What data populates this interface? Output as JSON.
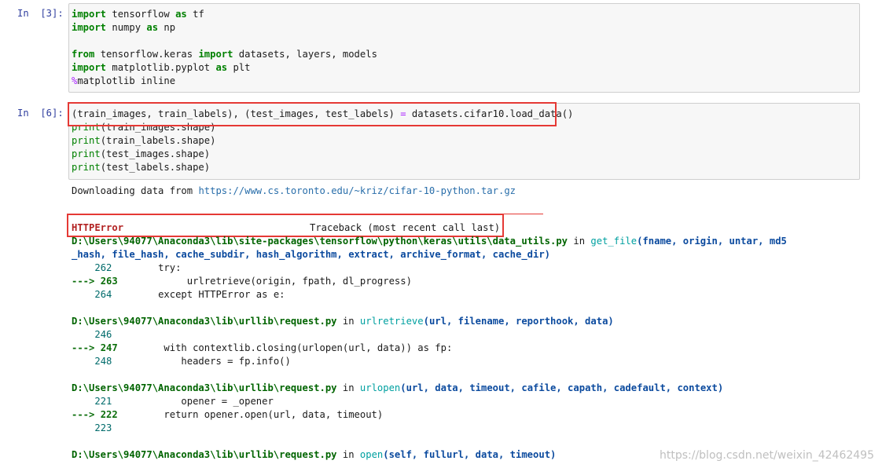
{
  "cell1": {
    "prompt": "In  [3]:",
    "lines": [
      [
        "import",
        " tensorflow ",
        "as",
        " tf"
      ],
      [
        "import",
        " numpy ",
        "as",
        " np"
      ],
      [
        "from",
        " tensorflow.keras ",
        "import",
        " datasets, layers, models"
      ],
      [
        "import",
        " matplotlib.pyplot ",
        "as",
        " plt"
      ],
      [
        "%",
        "matplotlib inline"
      ]
    ]
  },
  "cell2": {
    "prompt": "In  [6]:",
    "line0": "(train_images, train_labels), (test_images, test_labels) ",
    "line0_op": "=",
    "line0_rest": " datasets.cifar10.load_data()",
    "print_kw": "print",
    "prints": [
      "(train_images.shape)",
      "(train_labels.shape)",
      "(test_images.shape)",
      "(test_labels.shape)"
    ]
  },
  "output": {
    "download_prefix": "Downloading data from ",
    "download_url": "https://www.cs.toronto.edu/~kriz/cifar-10-python.tar.gz",
    "error_name": "HTTPError",
    "traceback_label": "Traceback (most recent call last)",
    "frames": [
      {
        "path": "D:\\Users\\94077\\Anaconda3\\lib\\site-packages\\tensorflow\\python\\keras\\utils\\data_utils.py",
        "in": " in ",
        "fn": "get_file",
        "args": "(fname, origin, untar, md5",
        "args2": "_hash, file_hash, cache_subdir, hash_algorithm, extract, archive_format, cache_dir)",
        "lines": [
          {
            "marker": "    ",
            "num": "262",
            "code": "        try:"
          },
          {
            "marker": "---> ",
            "num": "263",
            "code": "            urlretrieve(origin, fpath, dl_progress)"
          },
          {
            "marker": "    ",
            "num": "264",
            "code": "        except HTTPError as e:"
          }
        ]
      },
      {
        "path": "D:\\Users\\94077\\Anaconda3\\lib\\urllib\\request.py",
        "in": " in ",
        "fn": "urlretrieve",
        "args": "(url, filename, reporthook, data)",
        "lines": [
          {
            "marker": "    ",
            "num": "246",
            "code": ""
          },
          {
            "marker": "---> ",
            "num": "247",
            "code": "        with contextlib.closing(urlopen(url, data)) as fp:"
          },
          {
            "marker": "    ",
            "num": "248",
            "code": "            headers = fp.info()"
          }
        ]
      },
      {
        "path": "D:\\Users\\94077\\Anaconda3\\lib\\urllib\\request.py",
        "in": " in ",
        "fn": "urlopen",
        "args": "(url, data, timeout, cafile, capath, cadefault, context)",
        "lines": [
          {
            "marker": "    ",
            "num": "221",
            "code": "            opener = _opener"
          },
          {
            "marker": "---> ",
            "num": "222",
            "code": "        return opener.open(url, data, timeout)"
          },
          {
            "marker": "    ",
            "num": "223",
            "code": ""
          }
        ]
      },
      {
        "path": "D:\\Users\\94077\\Anaconda3\\lib\\urllib\\request.py",
        "in": " in ",
        "fn": "open",
        "args": "(self, fullurl, data, timeout)",
        "lines": []
      }
    ]
  },
  "watermark": "https://blog.csdn.net/weixin_42462495"
}
